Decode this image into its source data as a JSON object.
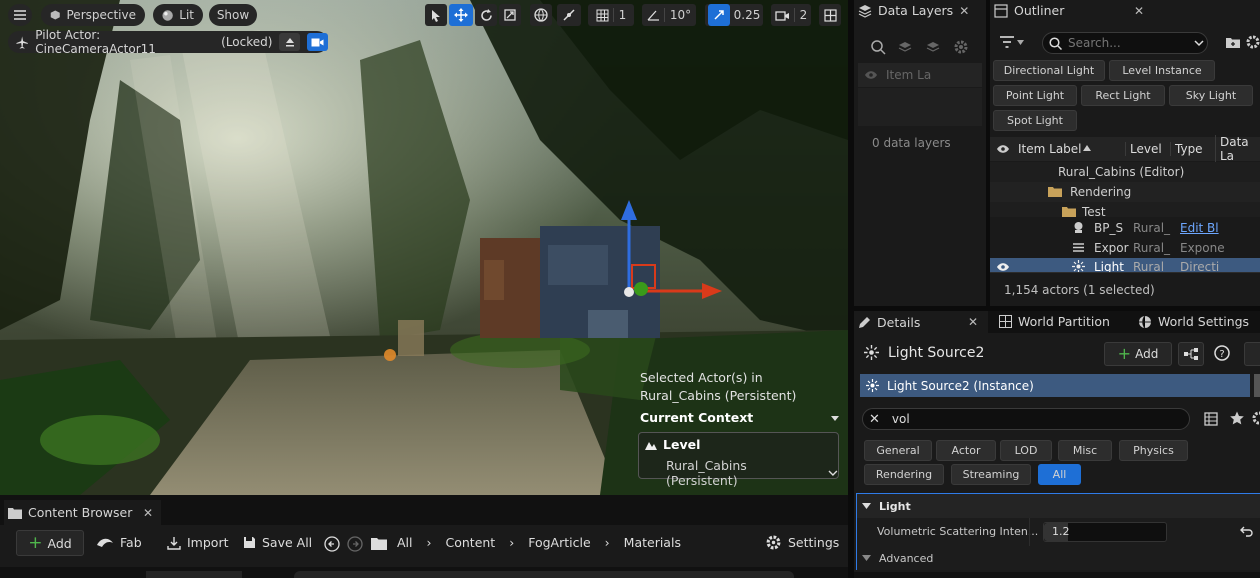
{
  "viewport": {
    "perspective_label": "Perspective",
    "lit_label": "Lit",
    "show_label": "Show",
    "grid_snap_value": "1",
    "rotation_snap_value": "10°",
    "scale_snap_value": "0.25",
    "camera_speed_value": "2",
    "pilot_label": "Pilot Actor: CineCameraActor11",
    "locked_label": "(Locked)",
    "selection_title": "Selected Actor(s) in",
    "selection_level": "Rural_Cabins (Persistent)",
    "current_context_label": "Current Context",
    "level_label": "Level",
    "level_value": "Rural_Cabins (Persistent)"
  },
  "data_layers": {
    "tab_label": "Data Layers",
    "column_label": "Item La",
    "empty_text": "0 data layers"
  },
  "outliner": {
    "tab_label": "Outliner",
    "search_placeholder": "Search...",
    "filter_chips": [
      "Directional Light",
      "Level Instance",
      "Point Light",
      "Rect Light",
      "Sky Light",
      "Spot Light"
    ],
    "columns": {
      "item_label": "Item Label",
      "level": "Level",
      "type": "Type",
      "data_layers": "Data La"
    },
    "tree": [
      {
        "label": "Rural_Cabins (Editor)",
        "level": "",
        "type": ""
      },
      {
        "label": "Rendering",
        "level": "",
        "type": ""
      },
      {
        "label": "Test",
        "level": "",
        "type": ""
      },
      {
        "label": "BP_S",
        "level": "Rural_",
        "type": "Edit Bl"
      },
      {
        "label": "Expor",
        "level": "Rural_",
        "type": "Expone"
      },
      {
        "label": "Light",
        "level": "Rural",
        "type": "Directi"
      }
    ],
    "status_text": "1,154 actors (1 selected)"
  },
  "details": {
    "tab_label": "Details",
    "world_partition_tab": "World Partition",
    "world_settings_tab": "World Settings",
    "actor_name": "Light Source2",
    "add_label": "Add",
    "instance_label": "Light Source2 (Instance)",
    "search_value": "vol",
    "filter_chips": [
      "General",
      "Actor",
      "LOD",
      "Misc",
      "Physics",
      "Rendering",
      "Streaming",
      "All"
    ],
    "section_light": "Light",
    "property_label": "Volumetric Scattering Inten...",
    "property_value": "1.2",
    "section_advanced": "Advanced"
  },
  "content_browser": {
    "tab_label": "Content Browser",
    "add_label": "Add",
    "fab_label": "Fab",
    "import_label": "Import",
    "save_all_label": "Save All",
    "breadcrumb": [
      "All",
      "Content",
      "FogArticle",
      "Materials"
    ],
    "settings_label": "Settings"
  },
  "colors": {
    "accent": "#1e6fd6",
    "panel": "#1a1a1a",
    "selection": "#3d5a80"
  }
}
